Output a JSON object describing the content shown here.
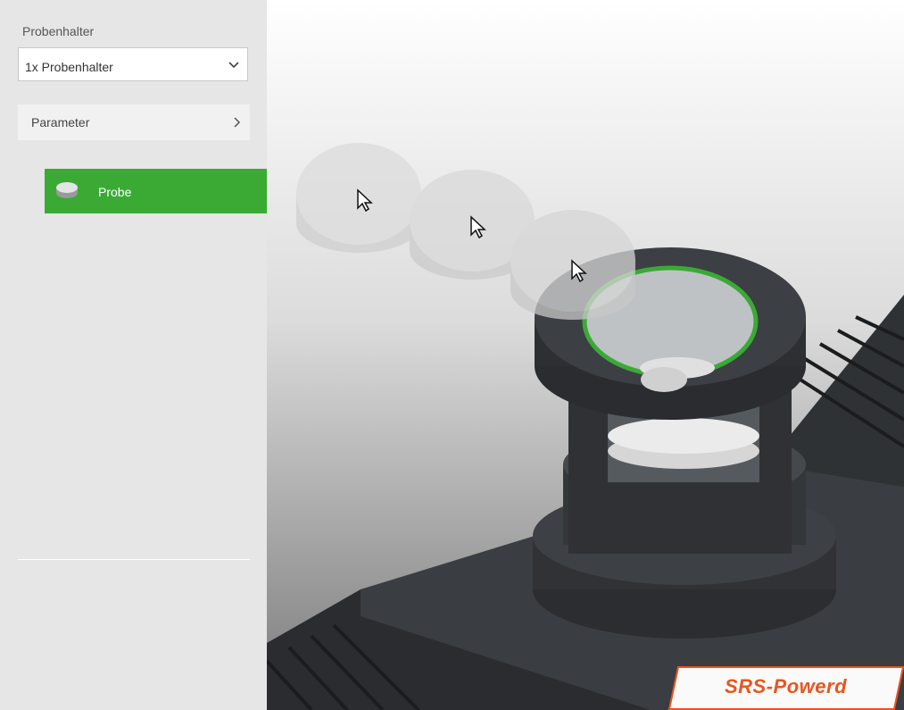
{
  "sidebar": {
    "holder_label": "Probenhalter",
    "holder_select_value": "1x Probenhalter",
    "parameter_label": "Parameter",
    "probe_label": "Probe"
  },
  "badge": {
    "text": "SRS-Powerd"
  },
  "colors": {
    "accent_green": "#3aaa35",
    "badge_text": "#e8561f",
    "sidebar_bg": "#e6e6e6"
  },
  "icons": [
    "chevron-down-icon",
    "chevron-right-icon",
    "sample-disc-icon",
    "cursor-icon"
  ]
}
